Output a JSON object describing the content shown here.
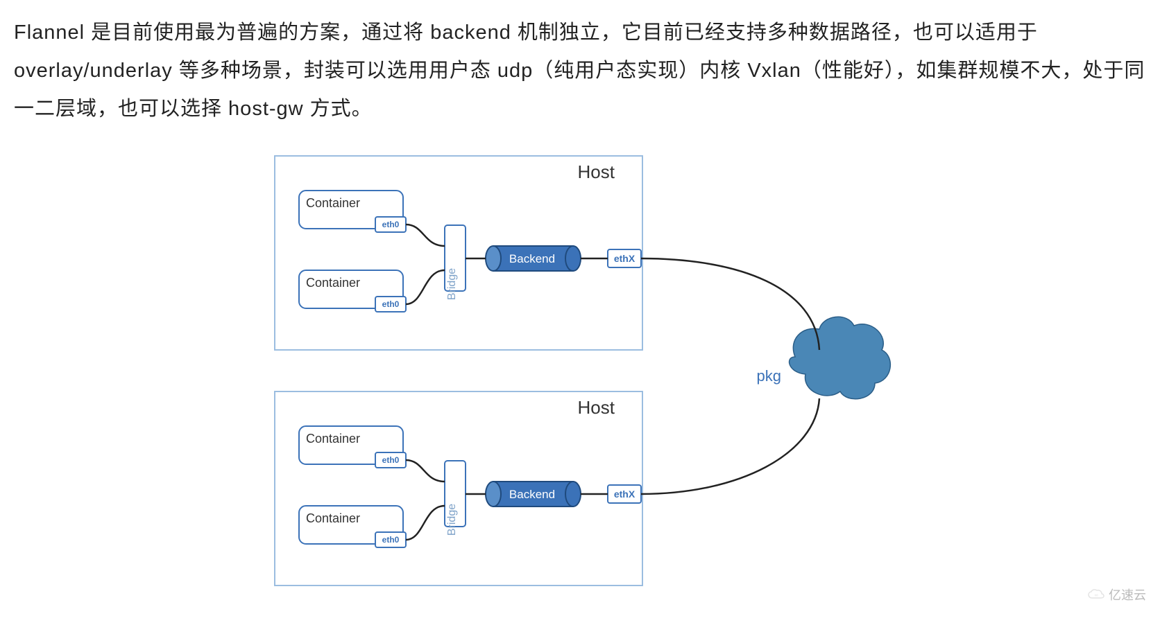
{
  "description": "Flannel 是目前使用最为普遍的方案，通过将 backend 机制独立，它目前已经支持多种数据路径，也可以适用于 overlay/underlay 等多种场景，封装可以选用用户态 udp（纯用户态实现）内核 Vxlan（性能好），如集群规模不大，处于同一二层域，也可以选择 host-gw 方式。",
  "diagram": {
    "hosts": [
      {
        "label": "Host",
        "containers": [
          {
            "label": "Container",
            "iface": "eth0"
          },
          {
            "label": "Container",
            "iface": "eth0"
          }
        ],
        "bridge": "Bridge",
        "backend": "Backend",
        "ethx": "ethX"
      },
      {
        "label": "Host",
        "containers": [
          {
            "label": "Container",
            "iface": "eth0"
          },
          {
            "label": "Container",
            "iface": "eth0"
          }
        ],
        "bridge": "Bridge",
        "backend": "Backend",
        "ethx": "ethX"
      }
    ],
    "pkg": "pkg"
  },
  "watermark": "亿速云"
}
